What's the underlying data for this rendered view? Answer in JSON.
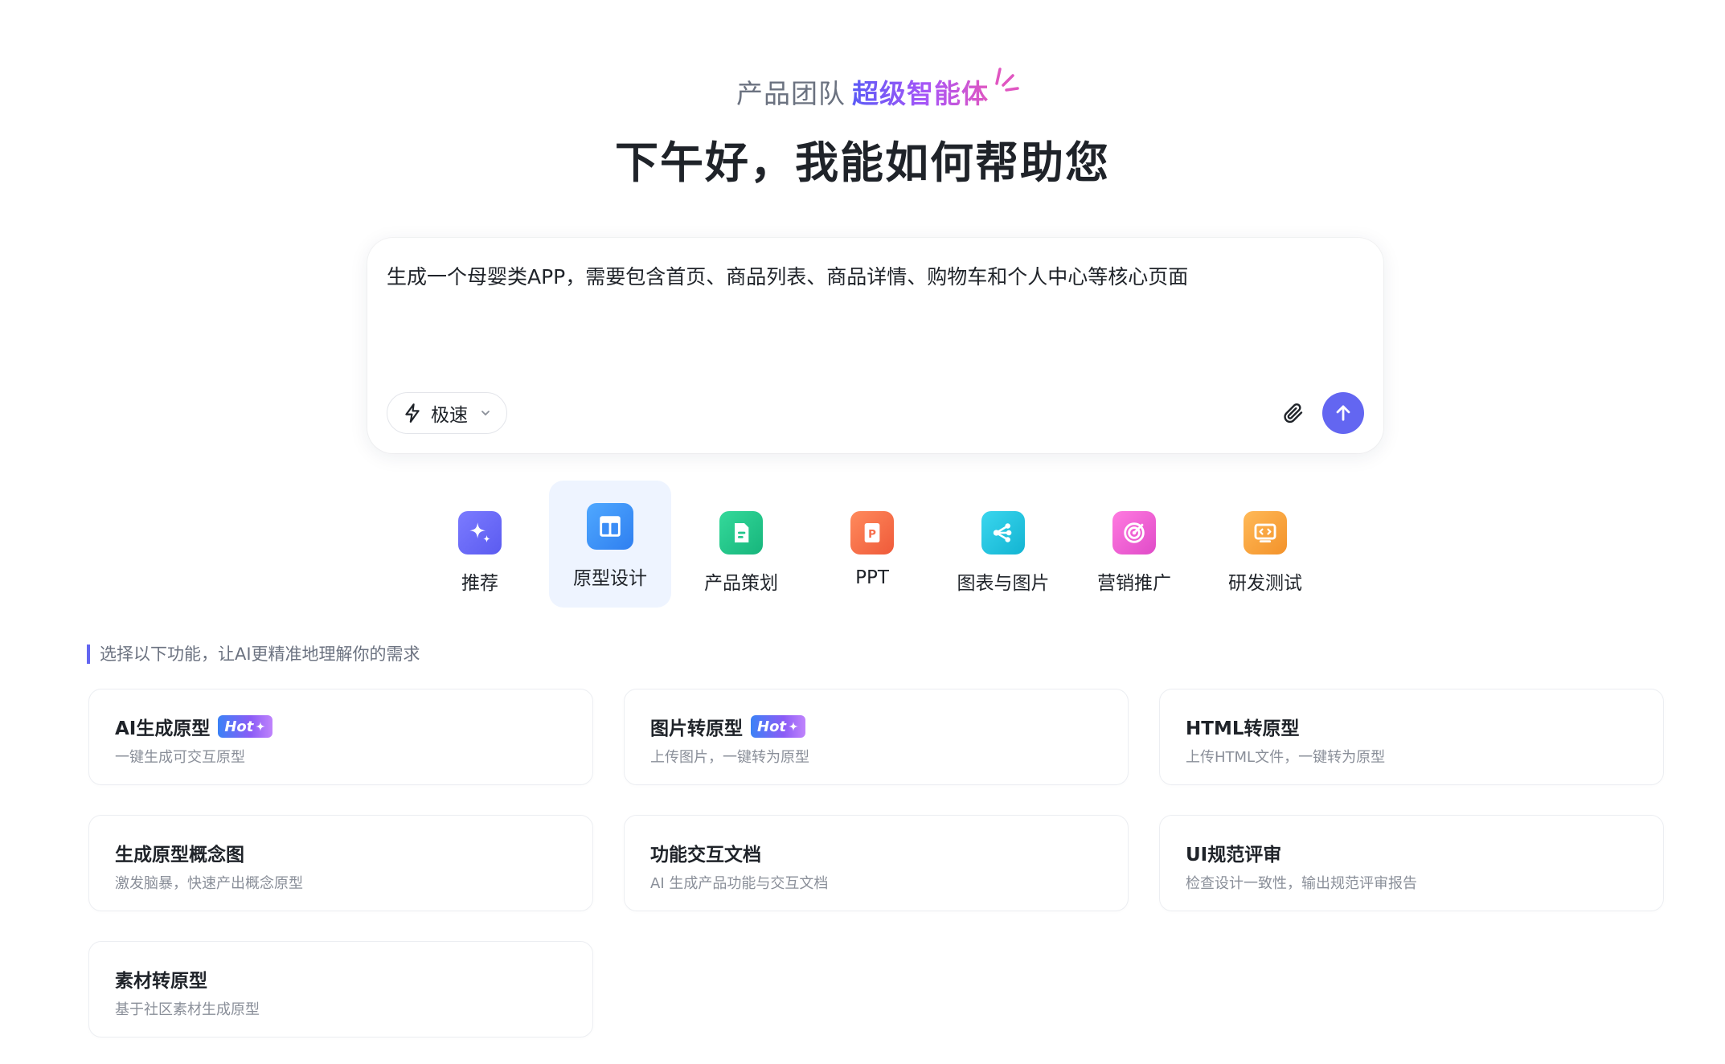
{
  "hero": {
    "team": "产品团队",
    "agent": "超级智能体",
    "greeting": "下午好，我能如何帮助您"
  },
  "prompt": {
    "value": "生成一个母婴类APP，需要包含首页、商品列表、商品详情、购物车和个人中心等核心页面",
    "mode_label": "极速"
  },
  "categories": [
    {
      "label": "推荐",
      "icon": "sparkle-icon",
      "color": "#6c6cf5"
    },
    {
      "label": "原型设计",
      "icon": "layout-icon",
      "color": "#3b8df6",
      "active": true
    },
    {
      "label": "产品策划",
      "icon": "document-icon",
      "color": "#22c58b"
    },
    {
      "label": "PPT",
      "icon": "ppt-icon",
      "color": "#f76b4a"
    },
    {
      "label": "图表与图片",
      "icon": "share-icon",
      "color": "#1fc6e0"
    },
    {
      "label": "营销推广",
      "icon": "target-icon",
      "color": "#ee5bd2"
    },
    {
      "label": "研发测试",
      "icon": "code-icon",
      "color": "#f7a23b"
    }
  ],
  "hint": "选择以下功能，让AI更精准地理解你的需求",
  "hot_label": "Hot",
  "cards": [
    {
      "title": "AI生成原型",
      "desc": "一键生成可交互原型",
      "hot": true
    },
    {
      "title": "图片转原型",
      "desc": "上传图片，一键转为原型",
      "hot": true
    },
    {
      "title": "HTML转原型",
      "desc": "上传HTML文件，一键转为原型",
      "hot": false
    },
    {
      "title": "生成原型概念图",
      "desc": "激发脑暴，快速产出概念原型",
      "hot": false
    },
    {
      "title": "功能交互文档",
      "desc": "AI 生成产品功能与交互文档",
      "hot": false
    },
    {
      "title": "UI规范评审",
      "desc": "检查设计一致性，输出规范评审报告",
      "hot": false
    },
    {
      "title": "素材转原型",
      "desc": "基于社区素材生成原型",
      "hot": false
    }
  ],
  "colors": {
    "accent": "#6366f1",
    "active_bg": "#eef4ff"
  }
}
